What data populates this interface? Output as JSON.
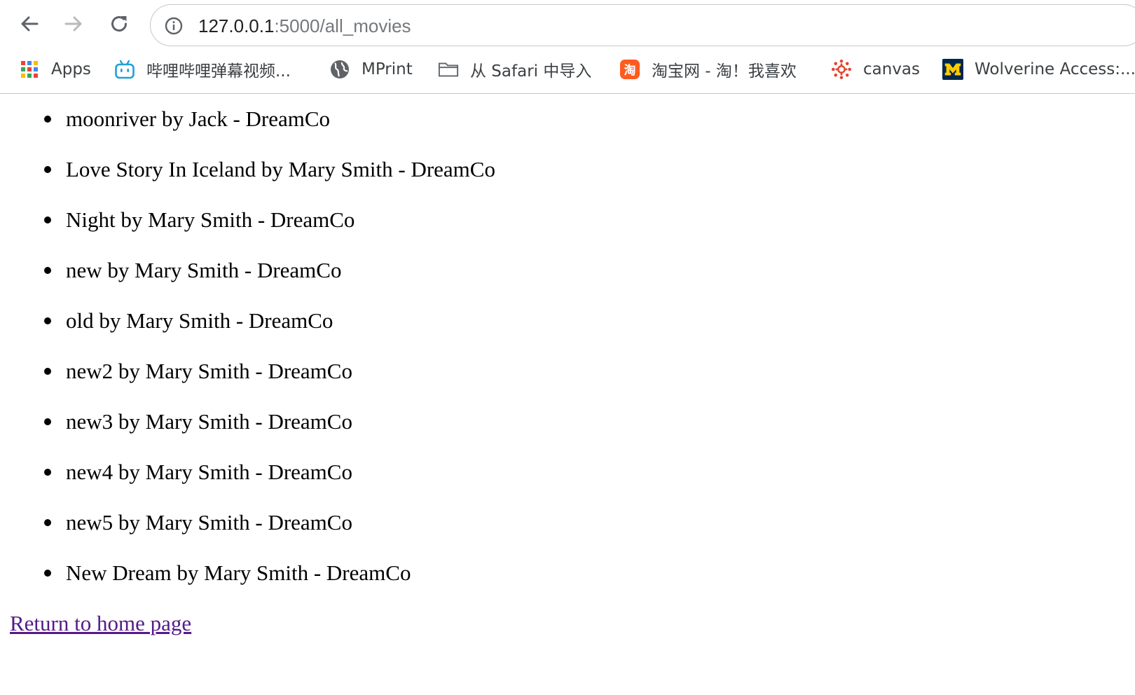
{
  "browser": {
    "url_host": "127.0.0.1",
    "url_rest": ":5000/all_movies",
    "bookmarks": [
      {
        "label": "Apps",
        "icon": "apps-grid-icon"
      },
      {
        "label": "哔哩哔哩弹幕视频...",
        "icon": "bilibili-icon"
      },
      {
        "label": "MPrint",
        "icon": "globe-icon"
      },
      {
        "label": "从 Safari 中导入",
        "icon": "folder-icon"
      },
      {
        "label": "淘宝网 - 淘！我喜欢",
        "icon": "taobao-icon"
      },
      {
        "label": "canvas",
        "icon": "canvas-icon"
      },
      {
        "label": "Wolverine Access:...",
        "icon": "michigan-m-icon"
      }
    ]
  },
  "page": {
    "movies": [
      "moonriver by Jack - DreamCo",
      "Love Story In Iceland by Mary Smith - DreamCo",
      "Night by Mary Smith - DreamCo",
      "new by Mary Smith - DreamCo",
      "old by Mary Smith - DreamCo",
      "new2 by Mary Smith - DreamCo",
      "new3 by Mary Smith - DreamCo",
      "new4 by Mary Smith - DreamCo",
      "new5 by Mary Smith - DreamCo",
      "New Dream by Mary Smith - DreamCo"
    ],
    "home_link": "Return to home page"
  },
  "colors": {
    "link_visited": "#551a8b",
    "chrome_text": "#3c4043",
    "url_secondary": "#75787c"
  }
}
